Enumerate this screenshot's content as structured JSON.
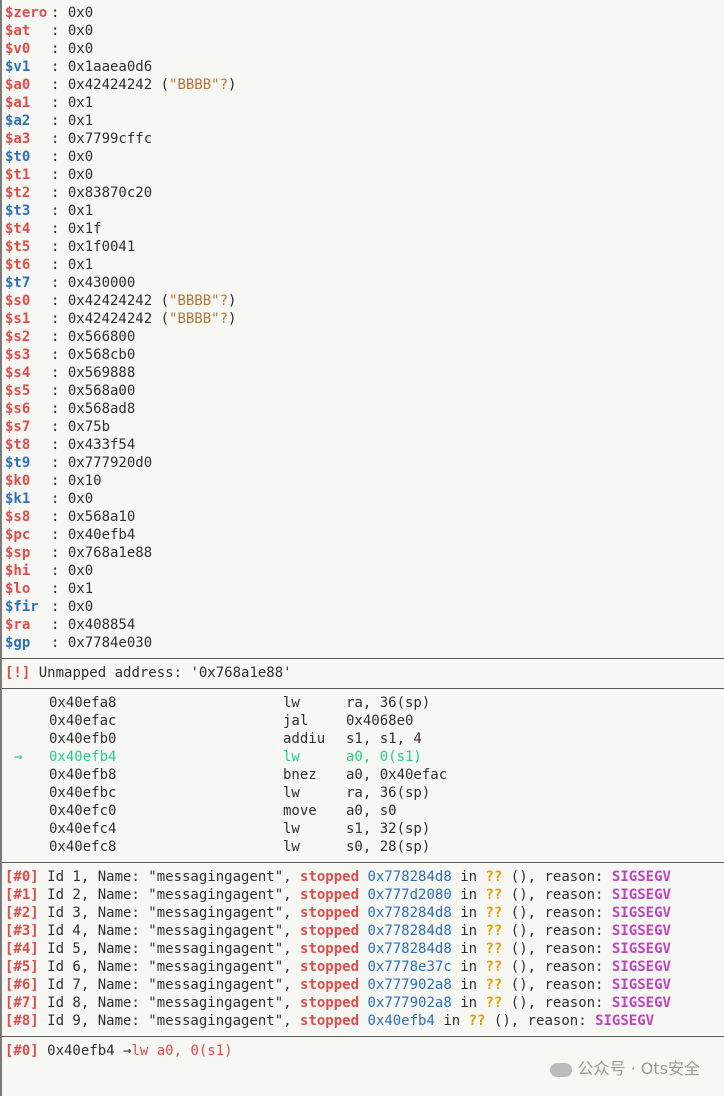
{
  "registers": [
    {
      "name": "$zero",
      "color": "red",
      "value": "0x0"
    },
    {
      "name": "$at",
      "color": "red",
      "value": "0x0"
    },
    {
      "name": "$v0",
      "color": "red",
      "value": "0x0"
    },
    {
      "name": "$v1",
      "color": "blue",
      "value": "0x1aaea0d6"
    },
    {
      "name": "$a0",
      "color": "red",
      "value": "0x42424242",
      "str": "\"BBBB\"?"
    },
    {
      "name": "$a1",
      "color": "red",
      "value": "0x1"
    },
    {
      "name": "$a2",
      "color": "blue",
      "value": "0x1"
    },
    {
      "name": "$a3",
      "color": "red",
      "value": "0x7799cffc"
    },
    {
      "name": "$t0",
      "color": "blue",
      "value": "0x0"
    },
    {
      "name": "$t1",
      "color": "red",
      "value": "0x0"
    },
    {
      "name": "$t2",
      "color": "red",
      "value": "0x83870c20"
    },
    {
      "name": "$t3",
      "color": "blue",
      "value": "0x1"
    },
    {
      "name": "$t4",
      "color": "red",
      "value": "0x1f"
    },
    {
      "name": "$t5",
      "color": "red",
      "value": "0x1f0041"
    },
    {
      "name": "$t6",
      "color": "red",
      "value": "0x1"
    },
    {
      "name": "$t7",
      "color": "blue",
      "value": "0x430000"
    },
    {
      "name": "$s0",
      "color": "red",
      "value": "0x42424242",
      "str": "\"BBBB\"?"
    },
    {
      "name": "$s1",
      "color": "red",
      "value": "0x42424242",
      "str": "\"BBBB\"?"
    },
    {
      "name": "$s2",
      "color": "red",
      "value": "0x566800"
    },
    {
      "name": "$s3",
      "color": "red",
      "value": "0x568cb0"
    },
    {
      "name": "$s4",
      "color": "red",
      "value": "0x569888"
    },
    {
      "name": "$s5",
      "color": "red",
      "value": "0x568a00"
    },
    {
      "name": "$s6",
      "color": "red",
      "value": "0x568ad8"
    },
    {
      "name": "$s7",
      "color": "red",
      "value": "0x75b"
    },
    {
      "name": "$t8",
      "color": "red",
      "value": "0x433f54"
    },
    {
      "name": "$t9",
      "color": "blue",
      "value": "0x777920d0"
    },
    {
      "name": "$k0",
      "color": "red",
      "value": "0x10"
    },
    {
      "name": "$k1",
      "color": "blue",
      "value": "0x0"
    },
    {
      "name": "$s8",
      "color": "red",
      "value": "0x568a10"
    },
    {
      "name": "$pc",
      "color": "red",
      "value": "0x40efb4"
    },
    {
      "name": "$sp",
      "color": "red",
      "value": "0x768a1e88"
    },
    {
      "name": "$hi",
      "color": "red",
      "value": "0x0"
    },
    {
      "name": "$lo",
      "color": "red",
      "value": "0x1"
    },
    {
      "name": "$fir",
      "color": "blue",
      "value": "0x0"
    },
    {
      "name": "$ra",
      "color": "red",
      "value": "0x408854"
    },
    {
      "name": "$gp",
      "color": "blue",
      "value": "0x7784e030"
    }
  ],
  "warning": {
    "tag": "[!]",
    "text": " Unmapped address: '0x768a1e88'"
  },
  "disasm": [
    {
      "addr": "0x40efa8",
      "mnem": "lw",
      "ops": "ra, 36(sp)",
      "current": false
    },
    {
      "addr": "0x40efac",
      "mnem": "jal",
      "ops": "0x4068e0",
      "current": false
    },
    {
      "addr": "0x40efb0",
      "mnem": "addiu",
      "ops": "s1, s1, 4",
      "current": false
    },
    {
      "addr": "0x40efb4",
      "mnem": "lw",
      "ops": "a0, 0(s1)",
      "current": true
    },
    {
      "addr": "0x40efb8",
      "mnem": "bnez",
      "ops": "a0, 0x40efac",
      "current": false
    },
    {
      "addr": "0x40efbc",
      "mnem": "lw",
      "ops": "ra, 36(sp)",
      "current": false
    },
    {
      "addr": "0x40efc0",
      "mnem": "move",
      "ops": "a0, s0",
      "current": false
    },
    {
      "addr": "0x40efc4",
      "mnem": "lw",
      "ops": "s1, 32(sp)",
      "current": false
    },
    {
      "addr": "0x40efc8",
      "mnem": "lw",
      "ops": "s0, 28(sp)",
      "current": false
    }
  ],
  "current_arrow": "→",
  "threads": [
    {
      "idx": "[#0]",
      "id": " Id 1, Name: \"messagingagent\", ",
      "state": "stopped",
      "addr": "0x778284d8",
      "mid": " in ",
      "fn": "??",
      "rest": " (), reason: ",
      "reason": "SIGSEGV"
    },
    {
      "idx": "[#1]",
      "id": " Id 2, Name: \"messagingagent\", ",
      "state": "stopped",
      "addr": "0x777d2080",
      "mid": " in ",
      "fn": "??",
      "rest": " (), reason: ",
      "reason": "SIGSEGV"
    },
    {
      "idx": "[#2]",
      "id": " Id 3, Name: \"messagingagent\", ",
      "state": "stopped",
      "addr": "0x778284d8",
      "mid": " in ",
      "fn": "??",
      "rest": " (), reason: ",
      "reason": "SIGSEGV"
    },
    {
      "idx": "[#3]",
      "id": " Id 4, Name: \"messagingagent\", ",
      "state": "stopped",
      "addr": "0x778284d8",
      "mid": " in ",
      "fn": "??",
      "rest": " (), reason: ",
      "reason": "SIGSEGV"
    },
    {
      "idx": "[#4]",
      "id": " Id 5, Name: \"messagingagent\", ",
      "state": "stopped",
      "addr": "0x778284d8",
      "mid": " in ",
      "fn": "??",
      "rest": " (), reason: ",
      "reason": "SIGSEGV"
    },
    {
      "idx": "[#5]",
      "id": " Id 6, Name: \"messagingagent\", ",
      "state": "stopped",
      "addr": "0x7778e37c",
      "mid": " in ",
      "fn": "??",
      "rest": " (), reason: ",
      "reason": "SIGSEGV"
    },
    {
      "idx": "[#6]",
      "id": " Id 7, Name: \"messagingagent\", ",
      "state": "stopped",
      "addr": "0x777902a8",
      "mid": " in ",
      "fn": "??",
      "rest": " (), reason: ",
      "reason": "SIGSEGV"
    },
    {
      "idx": "[#7]",
      "id": " Id 8, Name: \"messagingagent\", ",
      "state": "stopped",
      "addr": "0x777902a8",
      "mid": " in ",
      "fn": "??",
      "rest": " (), reason: ",
      "reason": "SIGSEGV"
    },
    {
      "idx": "[#8]",
      "id": " Id 9, Name: \"messagingagent\", ",
      "state": "stopped",
      "addr": "0x40efb4",
      "mid": " in ",
      "fn": "??",
      "rest": " (), reason: ",
      "reason": "SIGSEGV"
    }
  ],
  "trace": {
    "idx": "[#0]",
    "addr": " 0x40efb4 ",
    "arrow": "→",
    "instr": "lw a0, 0(s1)"
  },
  "watermark": "公众号 · Ots安全",
  "colors": {
    "red": "#e04b4b",
    "blue": "#2e6fba",
    "green": "#22cf8a",
    "purple": "#c044c0",
    "yellow": "#e0a000",
    "brown": "#b5763c",
    "background": "#f7f7f3"
  }
}
